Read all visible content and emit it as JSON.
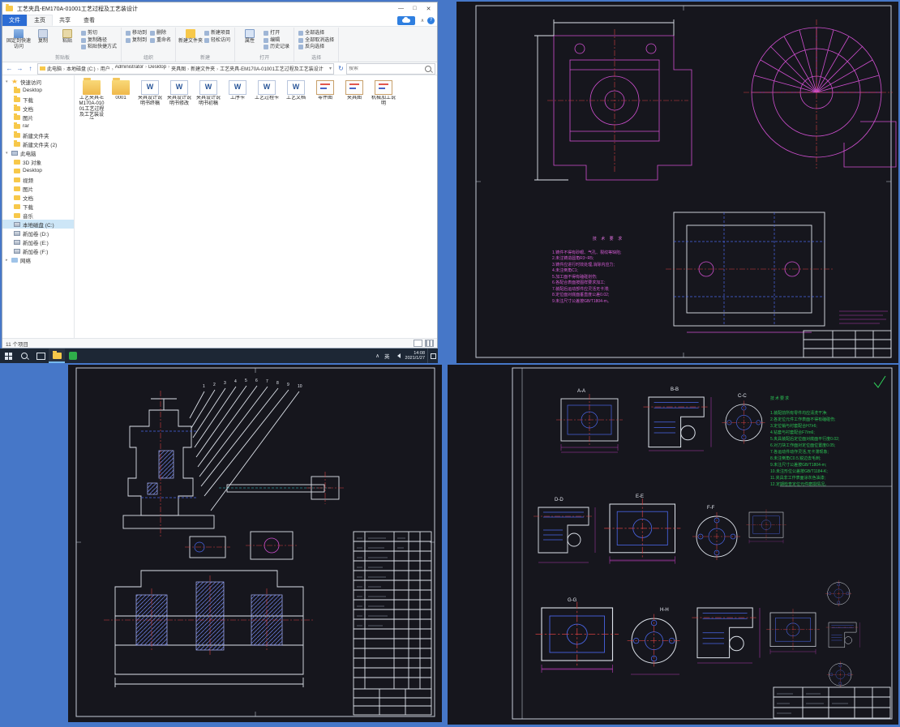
{
  "explorer": {
    "title": "工艺夹具-EM170A-01001工艺过程及工艺装设计",
    "window_controls": {
      "minimize": "—",
      "maximize": "□",
      "close": "✕"
    },
    "tabs": [
      "文件",
      "主页",
      "共享",
      "查看"
    ],
    "icons": {
      "word": "W",
      "help": "?",
      "collapse": "∧",
      "dropdown": "▾",
      "tree_open": "▾",
      "tree_closed": "▸"
    },
    "ribbon": {
      "pin": "固定到快速访问",
      "copy": "复制",
      "paste": "粘贴",
      "cut": "剪切",
      "copy_path": "复制路径",
      "paste_shortcut": "粘贴快捷方式",
      "move_to": "移动到",
      "copy_to": "复制到",
      "delete": "删除",
      "rename": "重命名",
      "new_folder": "新建文件夹",
      "new_item": "新建项目",
      "easy_access": "轻松访问",
      "properties": "属性",
      "open": "打开",
      "edit": "编辑",
      "history": "历史记录",
      "select_all": "全部选择",
      "select_none": "全部取消选择",
      "invert": "反向选择",
      "groups": [
        "剪贴板",
        "组织",
        "新建",
        "打开",
        "选择"
      ]
    },
    "nav": {
      "back": "←",
      "forward": "→",
      "up": "↑",
      "refresh": "↻"
    },
    "breadcrumbs": [
      "此电脑",
      "本地磁盘 (C:)",
      "用户",
      "Administrator",
      "Desktop",
      "夹具图",
      "新建文件夹",
      "工艺夹具-EM170A-01001工艺过程及工艺装设计"
    ],
    "search_placeholder": "搜索",
    "sidebar": {
      "quick_access_label": "快速访问",
      "quick_access": [
        "Desktop",
        "下载",
        "文档",
        "图片",
        "rar",
        "新建文件夹",
        "新建文件夹 (2)"
      ],
      "this_pc_label": "此电脑",
      "this_pc": [
        {
          "label": "3D 对象",
          "kind": "folder"
        },
        {
          "label": "Desktop",
          "kind": "folder"
        },
        {
          "label": "视频",
          "kind": "folder"
        },
        {
          "label": "图片",
          "kind": "folder"
        },
        {
          "label": "文档",
          "kind": "folder"
        },
        {
          "label": "下载",
          "kind": "folder"
        },
        {
          "label": "音乐",
          "kind": "folder"
        },
        {
          "label": "本地磁盘 (C:)",
          "kind": "drive",
          "sel": true
        },
        {
          "label": "新加卷 (D:)",
          "kind": "drive"
        },
        {
          "label": "新加卷 (E:)",
          "kind": "drive"
        },
        {
          "label": "新加卷 (F:)",
          "kind": "drive"
        }
      ],
      "network_label": "网络"
    },
    "files": [
      {
        "name": "工艺夹具-EM170A-01001工艺过程及工艺装设计",
        "type": "folder"
      },
      {
        "name": "0001",
        "type": "folder"
      },
      {
        "name": "夹具设计说明书终稿",
        "type": "docx"
      },
      {
        "name": "夹具设计说明书修改",
        "type": "docx"
      },
      {
        "name": "夹具设计说明书初稿",
        "type": "docx"
      },
      {
        "name": "工序卡",
        "type": "docx"
      },
      {
        "name": "工艺过程卡",
        "type": "docx"
      },
      {
        "name": "工艺文档",
        "type": "docx"
      },
      {
        "name": "零件图",
        "type": "dwg"
      },
      {
        "name": "夹具图",
        "type": "dwg"
      },
      {
        "name": "机械加工说明",
        "type": "dwg"
      }
    ],
    "status": "11 个项目"
  },
  "taskbar": {
    "time": "14:08",
    "date": "2021/1/27",
    "lang": "英",
    "tray_expand": "∧"
  },
  "cad1": {
    "notes_title": "技 术 要 求",
    "notes": "1.铸件不得有砂眼、气孔、裂纹等缺陷;\n2.未注铸造圆角R3~R5;\n3.铸件应进行时效处理,消除内应力;\n4.未注倒角C1;\n5.加工面不得有磕碰划伤;\n6.各配合表面按图样要求加工;\n7.装配后运动部件应灵活无卡滞;\n8.定位面对底面垂直度公差0.02;\n9.未注尺寸公差按GB/T1804-m。"
  },
  "cad2": {
    "balloons": [
      "1",
      "2",
      "3",
      "4",
      "5",
      "6",
      "7",
      "8",
      "9",
      "10"
    ]
  },
  "cad3": {
    "notes_title": "技术要求",
    "notes": "1.装配前所有零件均应清洗干净;\n2.各定位元件工作表面不得有磕碰伤;\n3.定位销与衬套配合H7/r6;\n4.钻套与衬套配合F7/m6;\n5.夹具装配后定位面对底面平行度0.02;\n6.对刀块工作面对定位面位置度0.05;\n7.各运动件动作灵活,无卡滞现象;\n8.未注倒角C0.5,锐边去毛刺;\n9.未注尺寸公差按GB/T1804-m;\n10.未注形位公差按GB/T1184-K;\n11.夹具非工作表面涂灰色油漆;\n12.定期检查定位元件磨损情况。",
    "sections": [
      "A-A",
      "B-B",
      "C-C",
      "D-D",
      "E-E",
      "F-F",
      "G-G",
      "H-H"
    ]
  }
}
